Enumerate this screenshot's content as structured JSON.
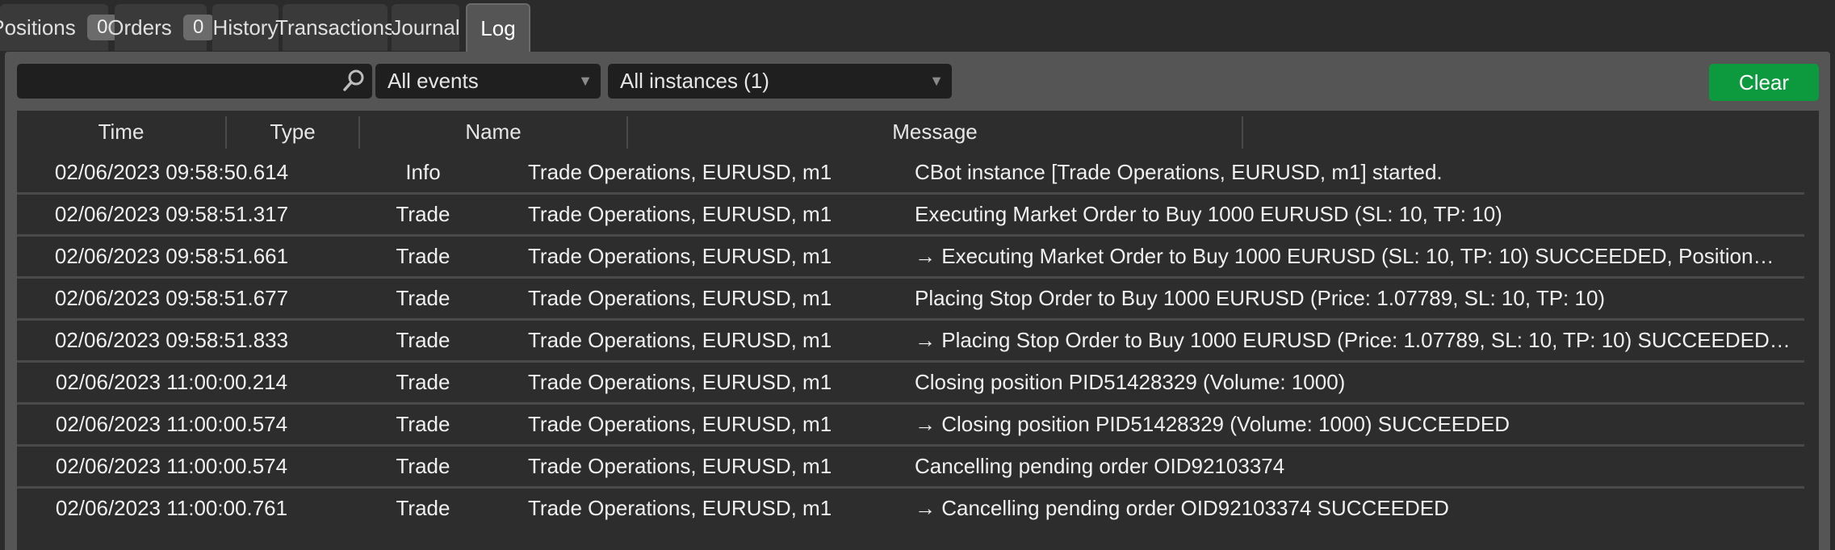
{
  "tabs": [
    {
      "label": "Positions",
      "badge": "0",
      "active": false
    },
    {
      "label": "Orders",
      "badge": "0",
      "active": false
    },
    {
      "label": "History",
      "active": false
    },
    {
      "label": "Transactions",
      "active": false
    },
    {
      "label": "Journal",
      "active": false
    },
    {
      "label": "Log",
      "active": true
    }
  ],
  "toolbar": {
    "search": {
      "value": "",
      "placeholder": ""
    },
    "events_filter": "All events",
    "instances_filter": "All instances (1)",
    "clear_label": "Clear"
  },
  "table": {
    "headers": {
      "time": "Time",
      "type": "Type",
      "name": "Name",
      "message": "Message"
    },
    "rows": [
      {
        "time": "02/06/2023 09:58:50.614",
        "type": "Info",
        "name": "Trade Operations, EURUSD, m1",
        "message": "CBot instance [Trade Operations, EURUSD, m1] started."
      },
      {
        "time": "02/06/2023 09:58:51.317",
        "type": "Trade",
        "name": "Trade Operations, EURUSD, m1",
        "message": "Executing Market Order to Buy 1000 EURUSD (SL: 10, TP: 10)"
      },
      {
        "time": "02/06/2023 09:58:51.661",
        "type": "Trade",
        "name": "Trade Operations, EURUSD, m1",
        "message": "→ Executing Market Order to Buy 1000 EURUSD (SL: 10, TP: 10) SUCCEEDED, Position…"
      },
      {
        "time": "02/06/2023 09:58:51.677",
        "type": "Trade",
        "name": "Trade Operations, EURUSD, m1",
        "message": "Placing Stop Order to Buy 1000 EURUSD (Price: 1.07789, SL: 10, TP: 10)"
      },
      {
        "time": "02/06/2023 09:58:51.833",
        "type": "Trade",
        "name": "Trade Operations, EURUSD, m1",
        "message": "→ Placing Stop Order to Buy 1000 EURUSD (Price: 1.07789, SL: 10, TP: 10) SUCCEEDED…"
      },
      {
        "time": "02/06/2023 11:00:00.214",
        "type": "Trade",
        "name": "Trade Operations, EURUSD, m1",
        "message": "Closing position PID51428329 (Volume: 1000)"
      },
      {
        "time": "02/06/2023 11:00:00.574",
        "type": "Trade",
        "name": "Trade Operations, EURUSD, m1",
        "message": "→ Closing position PID51428329 (Volume: 1000) SUCCEEDED"
      },
      {
        "time": "02/06/2023 11:00:00.574",
        "type": "Trade",
        "name": "Trade Operations, EURUSD, m1",
        "message": "Cancelling pending order OID92103374"
      },
      {
        "time": "02/06/2023 11:00:00.761",
        "type": "Trade",
        "name": "Trade Operations, EURUSD, m1",
        "message": "→ Cancelling pending order OID92103374 SUCCEEDED"
      }
    ]
  },
  "colors": {
    "background": "#2b2b2b",
    "panel": "#555555",
    "table_bg": "#2d2d2d",
    "accent_green": "#0d9a3f",
    "badge": "#6b6b6b"
  },
  "icons": {
    "search": "search-icon",
    "caret": "chevron-down-icon"
  }
}
